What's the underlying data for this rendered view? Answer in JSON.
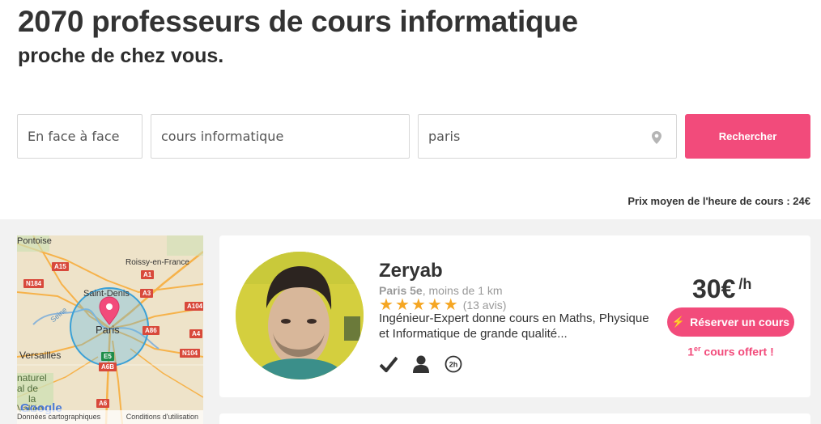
{
  "header": {
    "title": "2070 professeurs de cours informatique",
    "subtitle": "proche de chez vous."
  },
  "search": {
    "mode_value": "En face à face",
    "subject_value": "cours informatique",
    "location_value": "paris",
    "button_label": "Rechercher",
    "accent_color": "#f24b7b"
  },
  "avg_price_text": "Prix moyen de l'heure de cours : 24€",
  "map": {
    "labels": {
      "pontoise": "Pontoise",
      "roissy": "Roissy-en-France",
      "saint_denis": "Saint-Denis",
      "paris": "Paris",
      "versailles": "Versailles",
      "seine": "Seine",
      "naturel": "naturel",
      "al_de": "al de",
      "la": "la",
      "vallee": "Vallée"
    },
    "shields": {
      "a15": "A15",
      "a1": "A1",
      "n184": "N184",
      "a3": "A3",
      "a104": "A104",
      "a86": "A86",
      "a4": "A4",
      "n104": "N104",
      "e5": "E5",
      "a6b": "A6B",
      "a6": "A6"
    },
    "google": "Google",
    "footer_data": "Données cartographiques",
    "footer_terms": "Conditions d'utilisation"
  },
  "teacher": {
    "name": "Zeryab",
    "location_bold": "Paris 5e",
    "location_rest": ", moins de 1 km",
    "rating": 5,
    "reviews": "(13 avis)",
    "description": "Ingénieur-Expert donne cours en Maths, Physique et Informatique de grande qualité...",
    "price": "30€",
    "price_unit": "/h",
    "book_label": "Réserver un cours",
    "offer_prefix": "1",
    "offer_sup": "er",
    "offer_rest": " cours offert !",
    "badge_2h": "2h"
  }
}
